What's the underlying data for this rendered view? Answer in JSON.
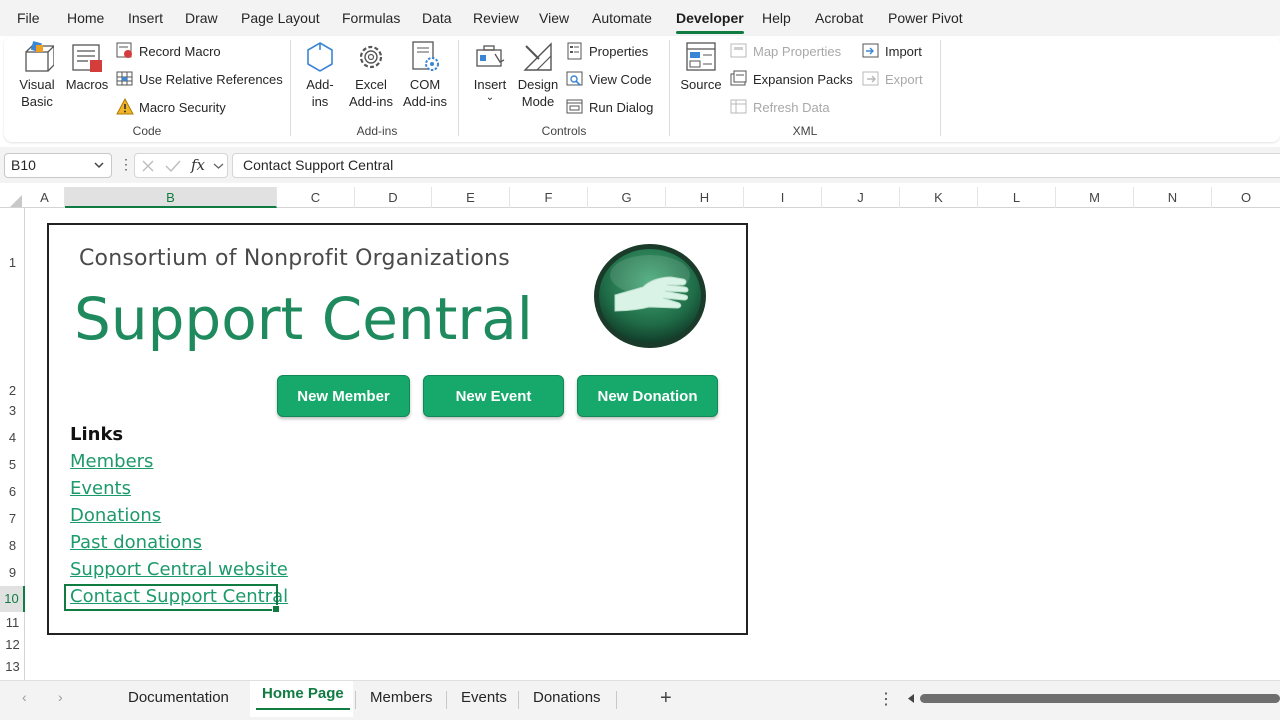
{
  "menu": {
    "tabs": [
      "File",
      "Home",
      "Insert",
      "Draw",
      "Page Layout",
      "Formulas",
      "Data",
      "Review",
      "View",
      "Automate",
      "Developer",
      "Help",
      "Acrobat",
      "Power Pivot"
    ],
    "active_tab": "Developer"
  },
  "ribbon": {
    "code": {
      "visual_basic_l1": "Visual",
      "visual_basic_l2": "Basic",
      "macros": "Macros",
      "record_macro": "Record Macro",
      "relative_refs": "Use Relative References",
      "macro_security": "Macro Security",
      "label": "Code"
    },
    "addins": {
      "addins_l1": "Add-",
      "addins_l2": "ins",
      "excel_addins_l1": "Excel",
      "excel_addins_l2": "Add-ins",
      "com_addins_l1": "COM",
      "com_addins_l2": "Add-ins",
      "label": "Add-ins"
    },
    "controls": {
      "insert": "Insert",
      "design_mode_l1": "Design",
      "design_mode_l2": "Mode",
      "properties": "Properties",
      "view_code": "View Code",
      "run_dialog": "Run Dialog",
      "label": "Controls"
    },
    "xml": {
      "source": "Source",
      "map_properties": "Map Properties",
      "expansion_packs": "Expansion Packs",
      "refresh_data": "Refresh Data",
      "import": "Import",
      "export": "Export",
      "label": "XML"
    }
  },
  "formula_bar": {
    "cell_ref": "B10",
    "dots": "⋮",
    "fx": "fx",
    "content": "Contact Support Central"
  },
  "grid": {
    "columns": [
      "A",
      "B",
      "C",
      "D",
      "E",
      "F",
      "G",
      "H",
      "I",
      "J",
      "K",
      "L",
      "M",
      "N",
      "O"
    ],
    "selected_column": "B",
    "rows": [
      "1",
      "2",
      "3",
      "4",
      "5",
      "6",
      "7",
      "8",
      "9",
      "10",
      "11",
      "12",
      "13"
    ],
    "selected_row": "10"
  },
  "home": {
    "organization": "Consortium of Nonprofit Organizations",
    "title": "Support Central",
    "buttons": {
      "new_member": "New Member",
      "new_event": "New Event",
      "new_donation": "New Donation"
    },
    "links_heading": "Links",
    "links": [
      "Members",
      "Events",
      "Donations",
      "Past donations",
      "Support Central website",
      "Contact Support Central"
    ]
  },
  "sheets": {
    "tabs": [
      "Documentation",
      "Home Page",
      "Members",
      "Events",
      "Donations"
    ],
    "active": "Home Page",
    "add": "+",
    "more": "⋮"
  },
  "colors": {
    "accent": "#107c41",
    "brand_green": "#1e8a5e",
    "button_green": "#17a86b"
  }
}
